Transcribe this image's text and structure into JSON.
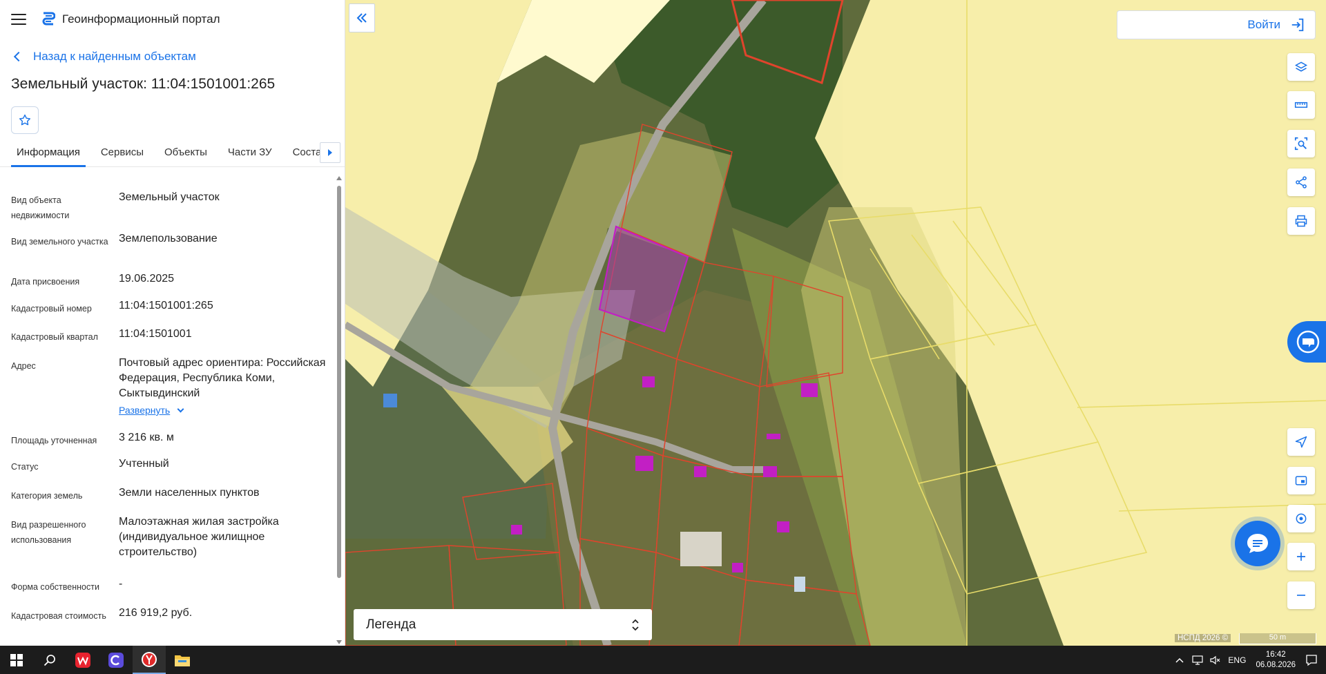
{
  "app": {
    "title": "Геоинформационный портал"
  },
  "nav": {
    "back_label": "Назад к найденным объектам"
  },
  "object": {
    "title": "Земельный участок: 11:04:1501001:265"
  },
  "tabs": [
    {
      "label": "Информация"
    },
    {
      "label": "Сервисы"
    },
    {
      "label": "Объекты"
    },
    {
      "label": "Части ЗУ"
    },
    {
      "label": "Состав"
    }
  ],
  "properties": [
    {
      "key": "Вид объекта недвижимости",
      "value": "Земельный участок"
    },
    {
      "key": "Вид земельного участка",
      "value": "Землепользование"
    },
    {
      "key": "Дата присвоения",
      "value": "19.06.2025"
    },
    {
      "key": "Кадастровый номер",
      "value": "11:04:1501001:265"
    },
    {
      "key": "Кадастровый квартал",
      "value": "11:04:1501001"
    },
    {
      "key": "Адрес",
      "value": "Почтовый адрес ориентира: Российская Федерация, Республика Коми, Сыктывдинский"
    },
    {
      "key": "Площадь уточненная",
      "value": "3 216 кв. м"
    },
    {
      "key": "Статус",
      "value": "Учтенный"
    },
    {
      "key": "Категория земель",
      "value": "Земли населенных пунктов"
    },
    {
      "key": "Вид разрешенного использования",
      "value": "Малоэтажная жилая застройка (индивидуальное жилищное строительство)"
    },
    {
      "key": "Форма собственности",
      "value": "-"
    },
    {
      "key": "Кадастровая стоимость",
      "value": "216 919,2 руб."
    }
  ],
  "address_expand_label": "Развернуть",
  "map": {
    "login_label": "Войти",
    "legend_label": "Легенда",
    "attribution": "НСПД 2026 ©",
    "scale_label": "50 m"
  },
  "taskbar": {
    "lang": "ENG",
    "time": "16:42",
    "date": "06.08.2026"
  },
  "colors": {
    "accent": "#1a73e8",
    "parcel_border": "#e0442c",
    "selected_parcel": "#c21fc4",
    "zone_fill": "#fff59a"
  }
}
